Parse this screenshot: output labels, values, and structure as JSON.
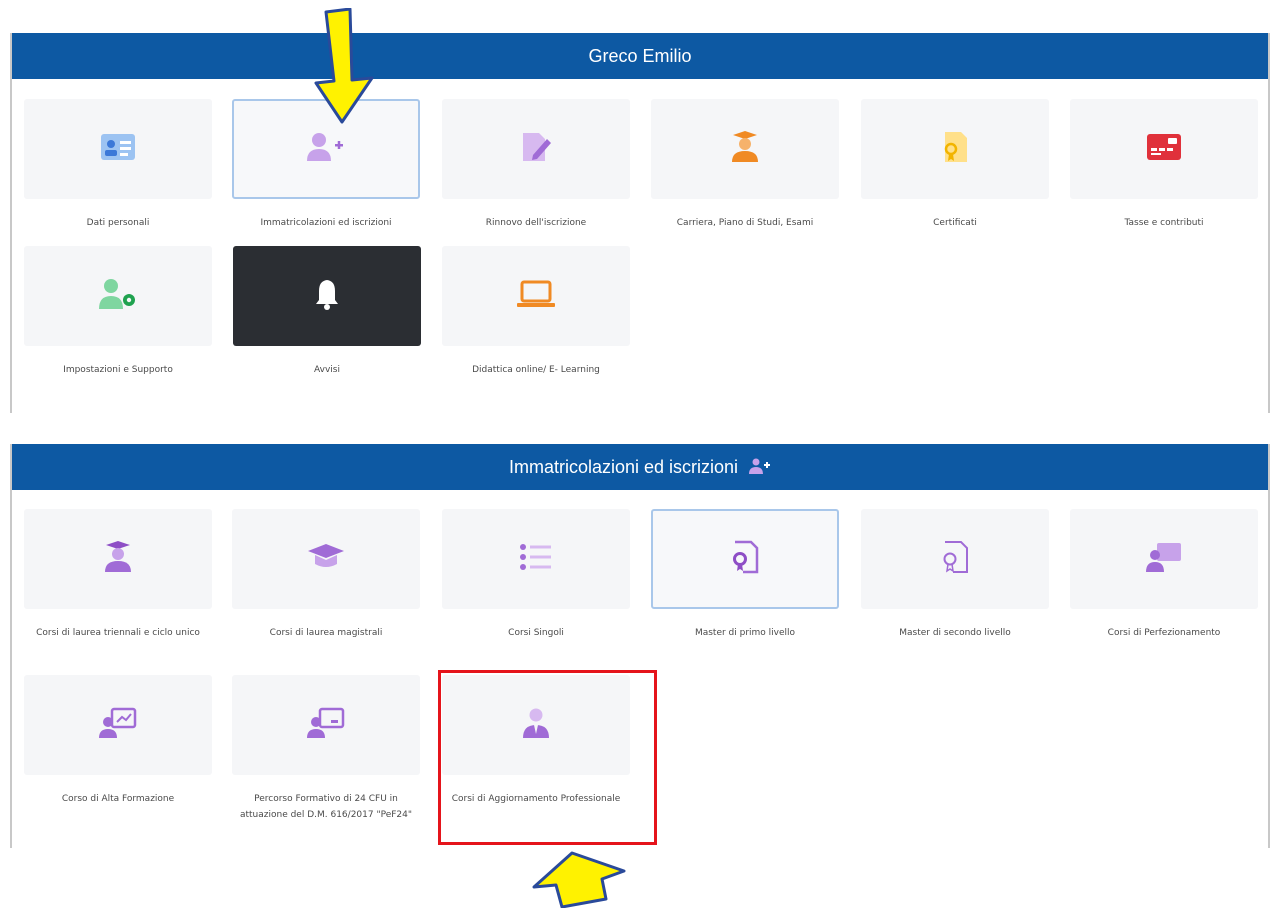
{
  "panel1": {
    "title": "Greco Emilio",
    "tiles": [
      {
        "label": "Dati personali",
        "icon": "id-card-icon"
      },
      {
        "label": "Immatricolazioni ed iscrizioni",
        "icon": "user-plus-icon"
      },
      {
        "label": "Rinnovo dell'iscrizione",
        "icon": "document-edit-icon"
      },
      {
        "label": "Carriera, Piano di Studi, Esami",
        "icon": "graduate-icon"
      },
      {
        "label": "Certificati",
        "icon": "certificate-icon"
      },
      {
        "label": "Tasse e contributi",
        "icon": "credit-card-icon"
      },
      {
        "label": "Impostazioni e Supporto",
        "icon": "user-gear-icon"
      },
      {
        "label": "Avvisi",
        "icon": "bell-icon"
      },
      {
        "label": "Didattica online/ E- Learning",
        "icon": "laptop-icon"
      }
    ]
  },
  "panel2": {
    "title": "Immatricolazioni ed iscrizioni",
    "tiles": [
      {
        "label": "Corsi di laurea triennali e ciclo unico",
        "icon": "graduate-icon"
      },
      {
        "label": "Corsi di laurea magistrali",
        "icon": "graduation-cap-icon"
      },
      {
        "label": "Corsi Singoli",
        "icon": "list-icon"
      },
      {
        "label": "Master di primo livello",
        "icon": "certificate-icon"
      },
      {
        "label": "Master di secondo livello",
        "icon": "certificate-outline-icon"
      },
      {
        "label": "Corsi di Perfezionamento",
        "icon": "presenter-icon"
      },
      {
        "label": "Corso di Alta Formazione",
        "icon": "presentation-chart-icon"
      },
      {
        "label": "Percorso Formativo di 24 CFU in attuazione del D.M. 616/2017 \"PeF24\"",
        "icon": "teacher-board-icon"
      },
      {
        "label": "Corsi di Aggiornamento Professionale",
        "icon": "business-person-icon"
      }
    ]
  },
  "colors": {
    "header": "#0d59a3",
    "purple": "#a06bd6",
    "highlight": "#e5141b",
    "arrow": "#fff200"
  }
}
